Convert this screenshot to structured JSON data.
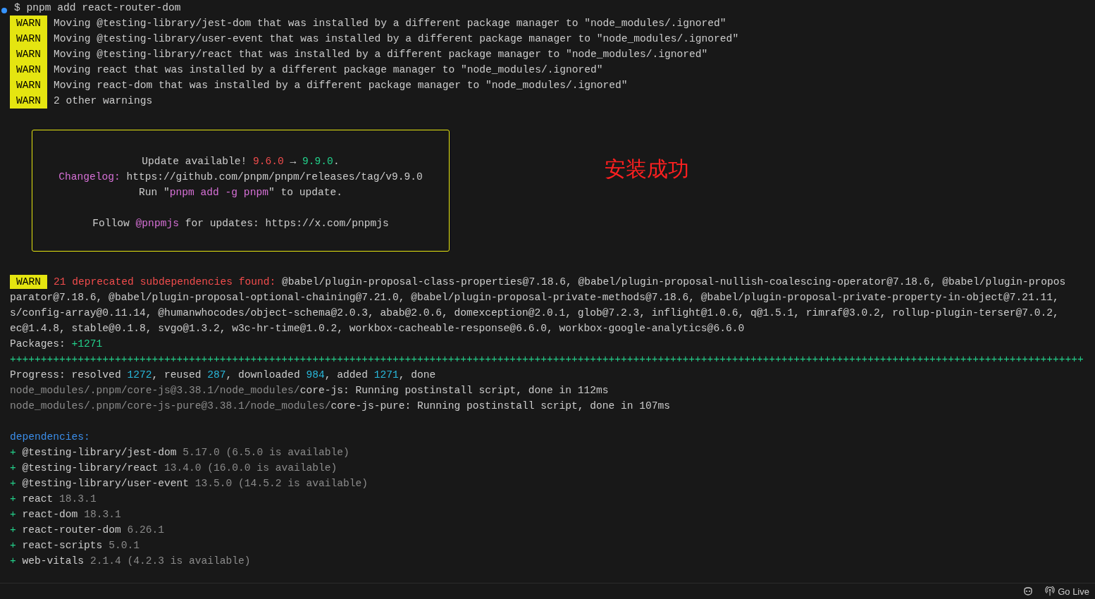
{
  "terminal": {
    "command": "$ pnpm add react-router-dom",
    "warnings": [
      {
        "badge": "WARN",
        "message": "Moving @testing-library/jest-dom that was installed by a different package manager to \"node_modules/.ignored\""
      },
      {
        "badge": "WARN",
        "message": "Moving @testing-library/user-event that was installed by a different package manager to \"node_modules/.ignored\""
      },
      {
        "badge": "WARN",
        "message": "Moving @testing-library/react that was installed by a different package manager to \"node_modules/.ignored\""
      },
      {
        "badge": "WARN",
        "message": "Moving react that was installed by a different package manager to \"node_modules/.ignored\""
      },
      {
        "badge": "WARN",
        "message": "Moving react-dom that was installed by a different package manager to \"node_modules/.ignored\""
      },
      {
        "badge": "WARN",
        "message": "2 other warnings"
      }
    ],
    "update_box": {
      "paragraphs": [
        [
          [
            {
              "text": "Update available! ",
              "kind": "plain"
            },
            {
              "text": "9.6.0",
              "kind": "error"
            },
            {
              "text": " → ",
              "kind": "plain"
            },
            {
              "text": "9.9.0",
              "kind": "success"
            },
            {
              "text": ".",
              "kind": "plain"
            }
          ],
          [
            {
              "text": "Changelog:",
              "kind": "accent"
            },
            {
              "text": " https://github.com/pnpm/pnpm/releases/tag/v9.9.0",
              "kind": "plain"
            }
          ],
          [
            {
              "text": "Run \"",
              "kind": "plain"
            },
            {
              "text": "pnpm add -g pnpm",
              "kind": "accent"
            },
            {
              "text": "\" to update.",
              "kind": "plain"
            }
          ]
        ],
        [
          [
            {
              "text": "Follow ",
              "kind": "plain"
            },
            {
              "text": "@pnpmjs",
              "kind": "accent"
            },
            {
              "text": " for updates: https://x.com/pnpmjs",
              "kind": "plain"
            }
          ]
        ]
      ]
    },
    "annotation": "安装成功",
    "deprecation": {
      "badge": "WARN",
      "title": "21 deprecated subdependencies found:",
      "lines": [
        " @babel/plugin-proposal-class-properties@7.18.6, @babel/plugin-proposal-nullish-coalescing-operator@7.18.6, @babel/plugin-propos",
        "parator@7.18.6, @babel/plugin-proposal-optional-chaining@7.21.0, @babel/plugin-proposal-private-methods@7.18.6, @babel/plugin-proposal-private-property-in-object@7.21.11,",
        "s/config-array@0.11.14, @humanwhocodes/object-schema@2.0.3, abab@2.0.6, domexception@2.0.1, glob@7.2.3, inflight@1.0.6, q@1.5.1, rimraf@3.0.2, rollup-plugin-terser@7.0.2,",
        "ec@1.4.8, stable@0.1.8, svgo@1.3.2, w3c-hr-time@1.0.2, workbox-cacheable-response@6.6.0, workbox-google-analytics@6.6.0"
      ]
    },
    "output": [
      [
        {
          "text": "Packages: ",
          "kind": "plain"
        },
        {
          "text": "+1271",
          "kind": "success"
        }
      ],
      [
        {
          "text": "++++++++++++++++++++++++++++++++++++++++++++++++++++++++++++++++++++++++++++++++++++++++++++++++++++++++++++++++++++++++++++++++++++++++++++++++++++++++++++++++++++++++++++++",
          "kind": "success"
        }
      ],
      [
        {
          "text": "Progress: resolved ",
          "kind": "plain"
        },
        {
          "text": "1272",
          "kind": "info"
        },
        {
          "text": ", reused ",
          "kind": "plain"
        },
        {
          "text": "287",
          "kind": "info"
        },
        {
          "text": ", downloaded ",
          "kind": "plain"
        },
        {
          "text": "984",
          "kind": "info"
        },
        {
          "text": ", added ",
          "kind": "plain"
        },
        {
          "text": "1271",
          "kind": "info"
        },
        {
          "text": ", done",
          "kind": "plain"
        }
      ],
      [
        {
          "text": "node_modules/.pnpm/core-js@3.38.1/node_modules/",
          "kind": "dim"
        },
        {
          "text": "core-js: Running postinstall script, done in 112ms",
          "kind": "plain"
        }
      ],
      [
        {
          "text": "node_modules/.pnpm/core-js-pure@3.38.1/node_modules/",
          "kind": "dim"
        },
        {
          "text": "core-js-pure: Running postinstall script, done in 107ms",
          "kind": "plain"
        }
      ]
    ],
    "dependencies_title": "dependencies:",
    "dependencies": [
      {
        "sign": "+",
        "name": "@testing-library/jest-dom",
        "version": "5.17.0",
        "note": "(6.5.0 is available)"
      },
      {
        "sign": "+",
        "name": "@testing-library/react",
        "version": "13.4.0",
        "note": "(16.0.0 is available)"
      },
      {
        "sign": "+",
        "name": "@testing-library/user-event",
        "version": "13.5.0",
        "note": "(14.5.2 is available)"
      },
      {
        "sign": "+",
        "name": "react",
        "version": "18.3.1"
      },
      {
        "sign": "+",
        "name": "react-dom",
        "version": "18.3.1"
      },
      {
        "sign": "+",
        "name": "react-router-dom",
        "version": "6.26.1"
      },
      {
        "sign": "+",
        "name": "react-scripts",
        "version": "5.0.1"
      },
      {
        "sign": "+",
        "name": "web-vitals",
        "version": "2.1.4",
        "note": "(4.2.3 is available)"
      }
    ]
  },
  "status_bar": {
    "items": [
      {
        "label": "Go Live"
      }
    ]
  }
}
